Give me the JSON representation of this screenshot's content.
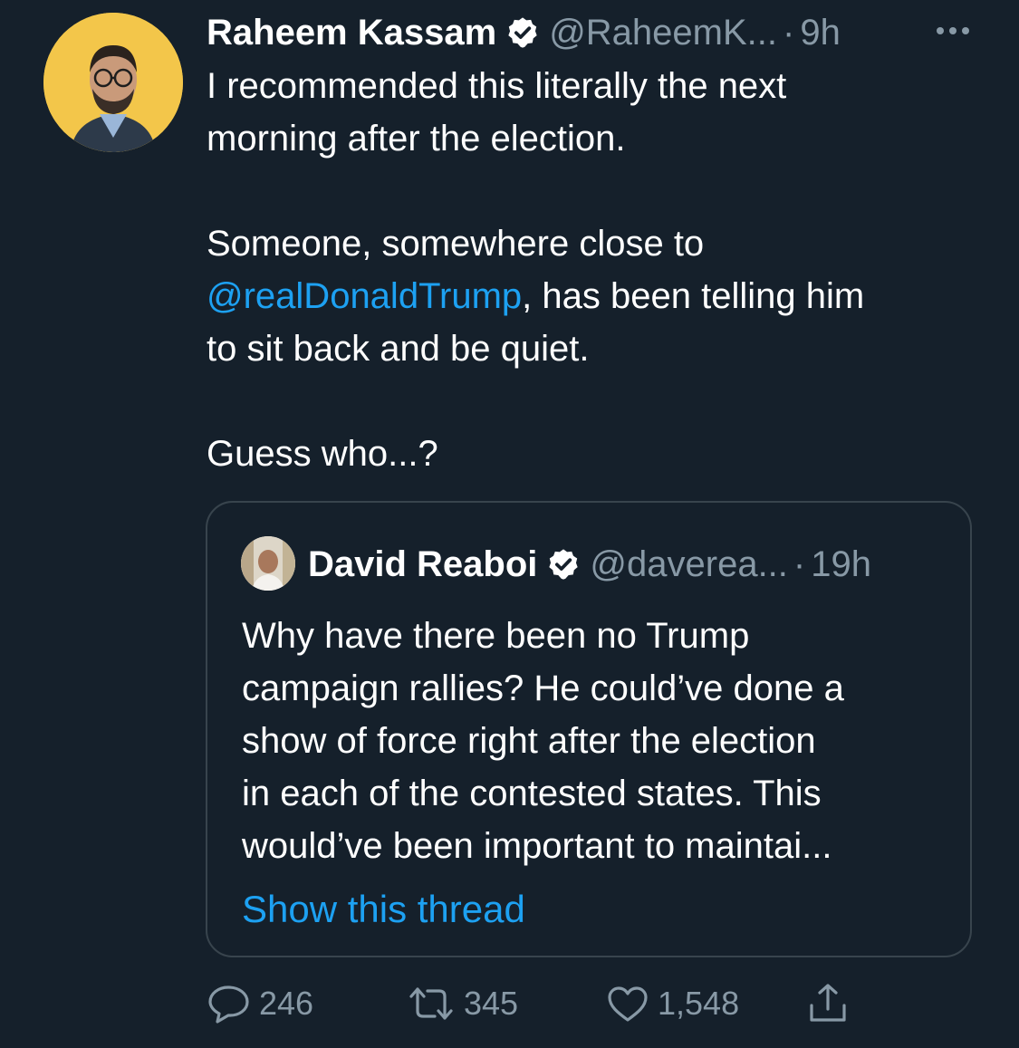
{
  "tweet": {
    "author_name": "Raheem Kassam",
    "handle": "@RaheemK...",
    "separator": "·",
    "time": "9h",
    "text_line1": "I recommended this literally the next",
    "text_line2": "morning after the election.",
    "text_line3": "Someone, somewhere close to",
    "mention": "@realDonaldTrump",
    "text_line4_rest": ", has been telling him",
    "text_line5": "to sit back and be quiet.",
    "text_line6": "Guess who...?"
  },
  "quoted": {
    "author_name": "David Reaboi",
    "handle": "@daverea...",
    "separator": "·",
    "time": "19h",
    "lines": [
      "Why have there been no Trump",
      "campaign rallies? He could’ve done a",
      "show of force right after the election",
      "in each of the contested states. This",
      "would’ve been important to maintai..."
    ],
    "show_thread": "Show this thread"
  },
  "actions": {
    "replies": "246",
    "retweets": "345",
    "likes": "1,548"
  },
  "icons": {
    "verified": "verified-badge-icon",
    "more": "more-options-icon",
    "reply": "reply-icon",
    "retweet": "retweet-icon",
    "like": "heart-icon",
    "share": "share-icon"
  },
  "colors": {
    "background": "#15202b",
    "text": "#ffffff",
    "muted": "#8899a6",
    "link": "#1da1f2",
    "border": "#38444d",
    "avatar_bg": "#f3c64a"
  }
}
